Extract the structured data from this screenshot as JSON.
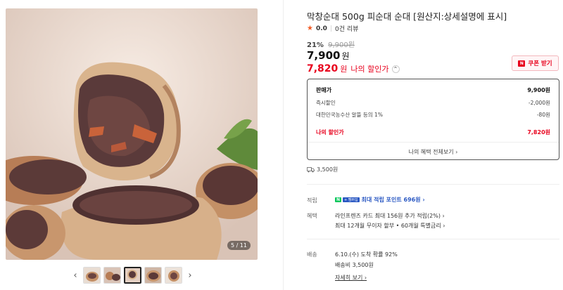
{
  "gallery": {
    "counter": "5 / 11",
    "prev_arrow": "‹",
    "next_arrow": "›",
    "thumb_count": 5,
    "active_thumb": 3
  },
  "product": {
    "title": "막창순대 500g 피순대 순대 [원산지:상세설명에 표시]",
    "rating": "0.0",
    "review_count": "0건 리뷰",
    "discount_pct": "21%",
    "original_price": "9,900원",
    "price": "7,900",
    "price_unit": "원",
    "my_price": "7,820",
    "my_price_unit": "원",
    "my_price_label": "나의 할인가"
  },
  "coupon": {
    "label": "쿠폰 받기",
    "badge": "N"
  },
  "breakdown": {
    "rows": [
      {
        "label": "판매가",
        "value": "9,900원"
      },
      {
        "label": "즉시할인",
        "value": "-2,000원"
      },
      {
        "label": "대한민국농수산 알뜰 등의 1%",
        "value": "-80원"
      }
    ],
    "my_label": "나의 할인가",
    "my_value": "7,820원",
    "more": "나의 혜택 전체보기 ›"
  },
  "shipping_cost": "3,500원",
  "points": {
    "label": "적립",
    "badge_n": "N",
    "badge_plus": "+ 멤버십",
    "text": "최대 적립 포인트 696원 ›"
  },
  "benefits": {
    "label": "혜택",
    "line1": "라인프렌즈 카드 최대 156원 추가 적립(2%) ›",
    "line2": "최대 12개월 무이자 할부 • 60개월 특별금리 ›"
  },
  "delivery": {
    "label": "배송",
    "line1": "6.10.(수) 도착 확률 92%",
    "line2": "배송비 3,500원",
    "detail_link": "자세히 보기 ›"
  },
  "colors": {
    "accent_red": "#e8001c",
    "link_blue": "#2b59c3",
    "naver_green": "#03c75a"
  }
}
